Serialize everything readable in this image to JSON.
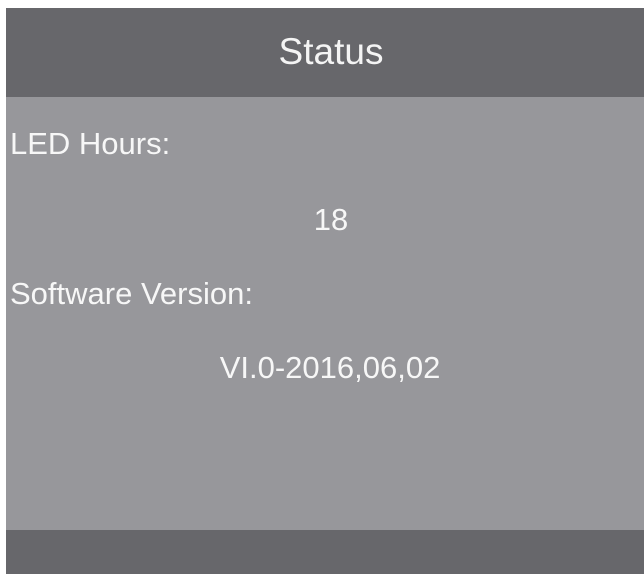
{
  "header": {
    "title": "Status"
  },
  "status": {
    "led_hours_label": "LED Hours:",
    "led_hours_value": "18",
    "software_version_label": "Software Version:",
    "software_version_value": "VI.0-2016,06,02"
  },
  "colors": {
    "background": "#97979b",
    "bar": "#67676b",
    "text": "#f7f7f7"
  }
}
